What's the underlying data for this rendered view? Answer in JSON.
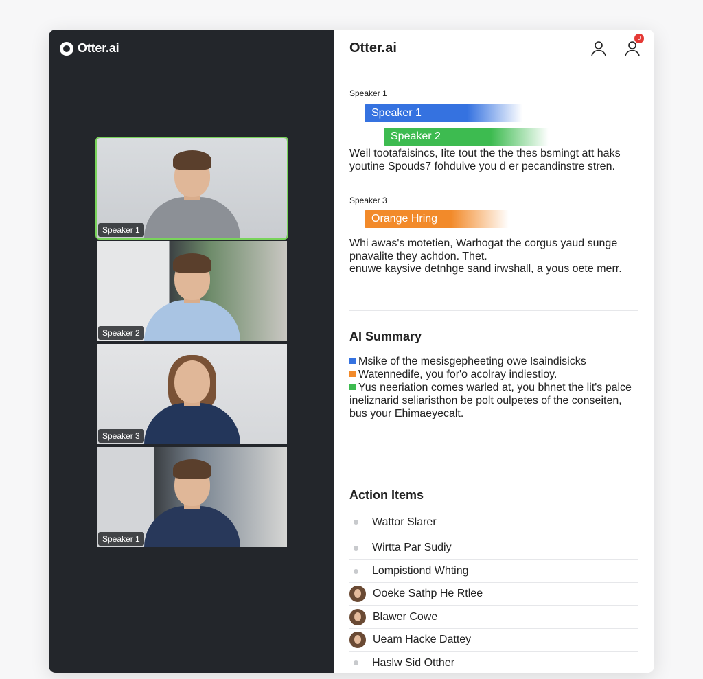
{
  "left_panel": {
    "brand": "Otter.ai",
    "tiles": [
      {
        "speaker": "Speaker 1",
        "active": true
      },
      {
        "speaker": "Speaker 2",
        "active": false
      },
      {
        "speaker": "Speaker 3",
        "active": false
      },
      {
        "speaker": "Speaker 1",
        "active": false
      }
    ]
  },
  "right_panel": {
    "title": "Otter.ai",
    "notification_count": "0",
    "transcript": {
      "section1_label": "Speaker 1",
      "bars": [
        "Speaker 1",
        "Speaker 2",
        "Orange Hring"
      ],
      "para1": "Weil tootafaisincs, Iite tout the the thes bsmingt att haks youtine Spouds7 fohduive you d er pecandinstre stren.",
      "section2_label": "Speaker 3",
      "para2_lines": [
        "Whi awas's motetien, Warhogat the corgus yaud sunge pnavalite they achdon. Thet.",
        "enuwe kaysive detnhge sand irwshall, a yous oete merr."
      ]
    },
    "summary": {
      "heading": "AI Summary",
      "lines": [
        {
          "text": "Msike of the mesisgepheeting owe Isaindisicks",
          "color": "#3572e0"
        },
        {
          "text": "Watennedife, you for'o acolray indiestioy.",
          "color": "#f28a2a"
        },
        {
          "text": "Yus neeriation comes warled at, you bhnet the lit's palce ineliznarid seliaristhon be polt oulpetes of the conseiten, bus your Ehimaeyecalt.",
          "color": "#3dbb50"
        }
      ]
    },
    "actions": {
      "heading": "Action Items",
      "items": [
        {
          "text": "Wattor Slarer",
          "kind": "dot"
        },
        {
          "text": "Wirtta Par Sudiy",
          "kind": "dot"
        },
        {
          "text": "Lompistiond Whting",
          "kind": "dot"
        },
        {
          "text": "Ooeke Sathp He Rtlee",
          "kind": "avatar"
        },
        {
          "text": "Blawer Cowe",
          "kind": "avatar"
        },
        {
          "text": "Ueam Hacke Dattey",
          "kind": "avatar"
        },
        {
          "text": "Haslw Sid Otther",
          "kind": "dot"
        }
      ]
    }
  }
}
